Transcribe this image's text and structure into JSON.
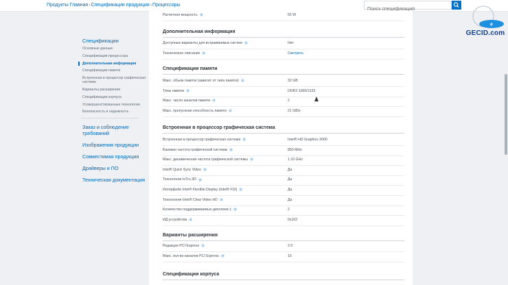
{
  "breadcrumb": {
    "items": [
      "Продукты Главная",
      "Спецификации продукции",
      "Процессоры"
    ],
    "separator": "›"
  },
  "search": {
    "placeholder": "Поиск спецификаций",
    "icon": "search-icon"
  },
  "watermark": {
    "logo": "GECID.com",
    "text": "GECID.com"
  },
  "sidebar": {
    "title": "Спецификации",
    "items": [
      "Основные данные",
      "Спецификации процессора",
      "Дополнительная информация",
      "Спецификации памяти",
      "Встроенная в процессор графическая система",
      "Варианты расширения",
      "Спецификации корпуса",
      "Усовершенствованные технологии",
      "Безопасность и надежность"
    ],
    "active_index": 2,
    "links": [
      "Заказ и соблюдение требований",
      "Изображения продукции",
      "Совместимая продукция",
      "Драйверы и ПО",
      "Техническая документация"
    ]
  },
  "spec": {
    "top_row": {
      "label": "Расчетная мощность",
      "value": "65 W"
    },
    "sections": [
      {
        "title": "Дополнительная информация",
        "rows": [
          {
            "label": "Доступные варианты для встраиваемых систем",
            "value": "Нет",
            "link": false
          },
          {
            "label": "Техническое описание",
            "value": "Смотреть",
            "link": true
          }
        ]
      },
      {
        "title": "Спецификации памяти",
        "rows": [
          {
            "label": "Макс. объем памяти (зависит от типа памяти)",
            "value": "32 GB",
            "link": false
          },
          {
            "label": "Типы памяти",
            "value": "DDR3 1066/1333",
            "link": false
          },
          {
            "label": "Макс. число каналов памяти",
            "value": "2",
            "link": false
          },
          {
            "label": "Макс. пропускная способность памяти",
            "value": "21 GB/s",
            "link": false
          }
        ]
      },
      {
        "title": "Встроенная в процессор графическая система",
        "rows": [
          {
            "label": "Встроенная в процессор графическая система",
            "value": "Intel® HD Graphics 2000",
            "link": false
          },
          {
            "label": "Базовая частота графической системы",
            "value": "850 MHz",
            "link": false
          },
          {
            "label": "Макс. динамическая частота графической системы",
            "value": "1.10 GHz",
            "link": false
          },
          {
            "label": "Intel® Quick Sync Video",
            "value": "Да",
            "link": false
          },
          {
            "label": "Технология InTru 3D",
            "value": "Да",
            "link": false
          },
          {
            "label": "Интерфейс Intel® Flexible Display (Intel® FDI)",
            "value": "Да",
            "link": false
          },
          {
            "label": "Технология Intel® Clear Video HD",
            "value": "Да",
            "link": false
          },
          {
            "label": "Количество поддерживаемых дисплеев ‡",
            "value": "2",
            "link": false
          },
          {
            "label": "ИД устройства",
            "value": "0x102",
            "link": false
          }
        ]
      },
      {
        "title": "Варианты расширения",
        "rows": [
          {
            "label": "Редакция PCI Express",
            "value": "2.0",
            "link": false
          },
          {
            "label": "Макс. кол-во каналов PCI Express",
            "value": "16",
            "link": false
          }
        ]
      },
      {
        "title": "Спецификации корпуса",
        "rows": []
      }
    ]
  },
  "colors": {
    "accent": "#0068b5",
    "search_button": "#0071c5",
    "page_bg": "#eef0f3"
  }
}
